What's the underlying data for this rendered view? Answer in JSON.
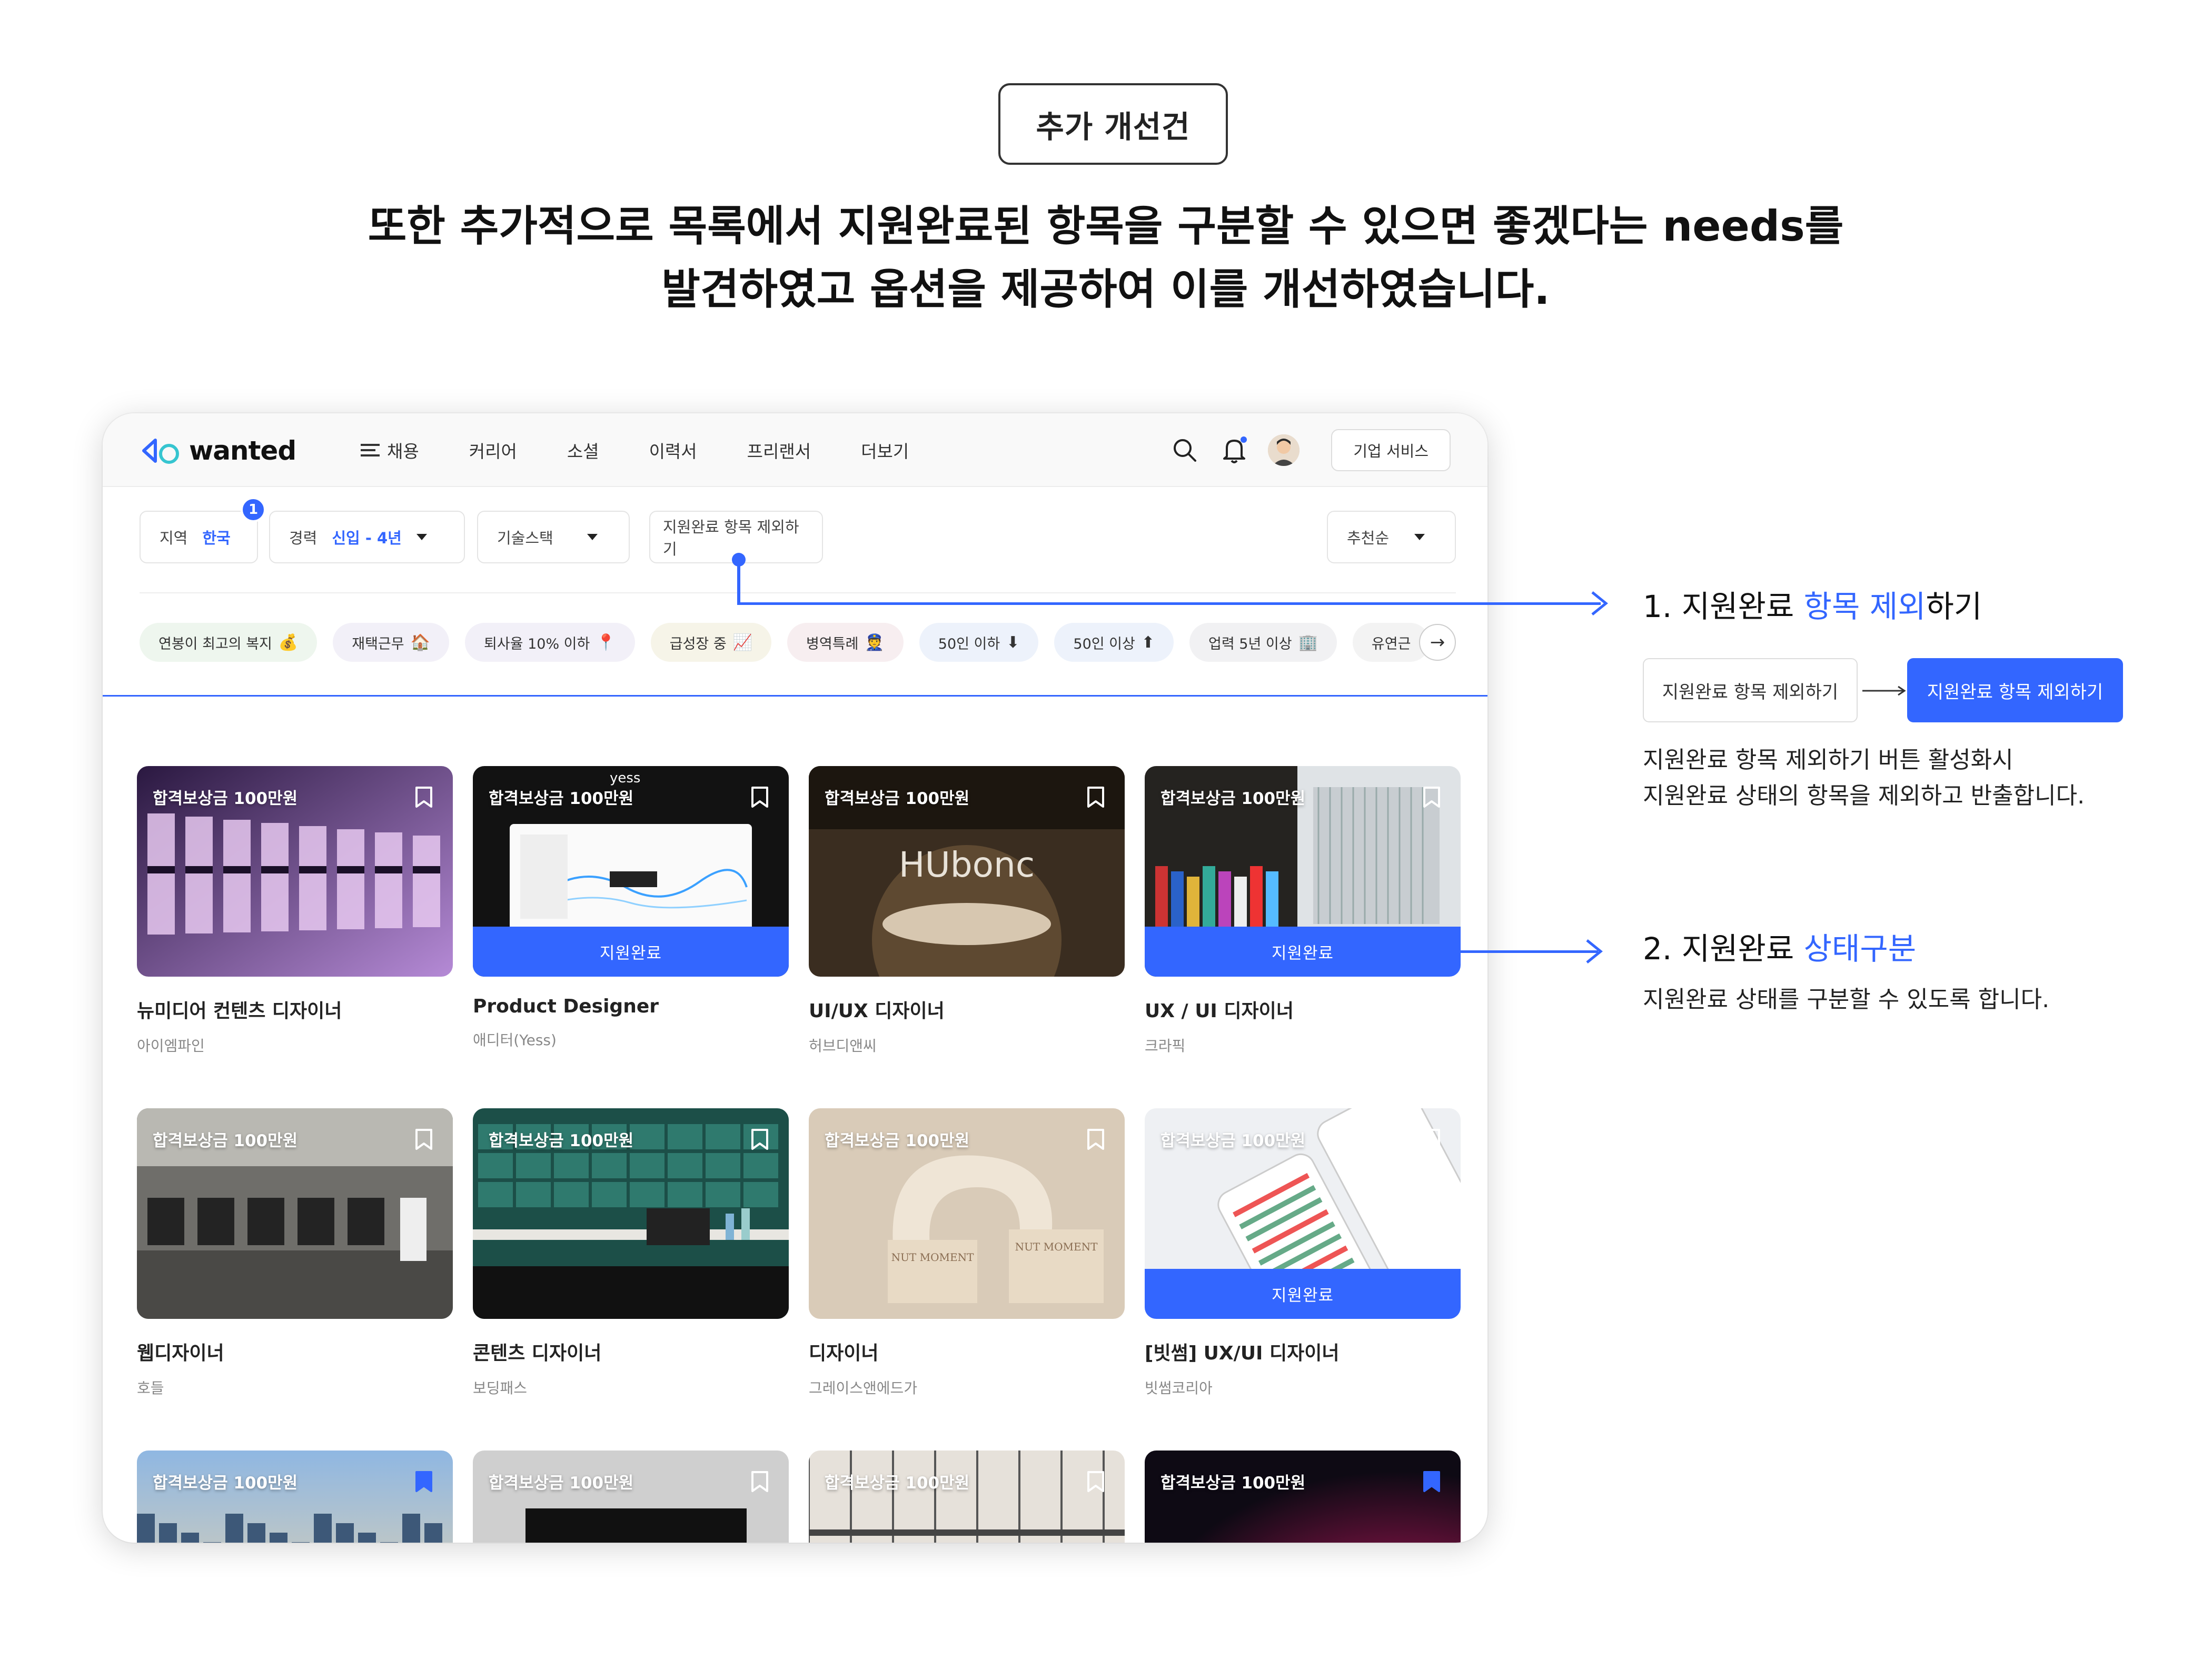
{
  "header": {
    "tag": "추가 개선건",
    "line1": "또한 추가적으로 목록에서 지원완료된 항목을 구분할 수 있으면 좋겠다는 needs를",
    "line2": "발견하였고 옵션을 제공하여 이를 개선하였습니다."
  },
  "nav": {
    "logo": "wanted",
    "menu": [
      "채용",
      "커리어",
      "소셜",
      "이력서",
      "프리랜서",
      "더보기"
    ],
    "business_button": "기업 서비스"
  },
  "filters": {
    "region_label": "지역",
    "region_value": "한국",
    "region_badge": "1",
    "career_label": "경력",
    "career_value": "신입 - 4년",
    "skill_label": "기술스택",
    "exclude_label": "지원완료 항목 제외하기",
    "sort_label": "추천순"
  },
  "tags": [
    {
      "label": "연봉이 최고의 복지",
      "emoji": "💰",
      "bg": "#eef6ee"
    },
    {
      "label": "재택근무",
      "emoji": "🏠",
      "bg": "#f2f0f8"
    },
    {
      "label": "퇴사율 10% 이하",
      "emoji": "📍",
      "bg": "#f2f0f8"
    },
    {
      "label": "급성장 중",
      "emoji": "📈",
      "bg": "#f6f4e8"
    },
    {
      "label": "병역특례",
      "emoji": "👮",
      "bg": "#f7eef0"
    },
    {
      "label": "50인 이하",
      "emoji": "⬇",
      "bg": "#edf2fb"
    },
    {
      "label": "50인 이상",
      "emoji": "⬆",
      "bg": "#edf2fb"
    },
    {
      "label": "업력 5년 이상",
      "emoji": "🏢",
      "bg": "#f1f1f3"
    },
    {
      "label": "유연근",
      "emoji": "",
      "bg": "#f3f3f3"
    }
  ],
  "card_reward": "합격보상금 100만원",
  "applied_label": "지원완료",
  "cards": [
    {
      "title": "뉴미디어 컨텐츠 디자이너",
      "company": "아이엠파인",
      "applied": false,
      "bookmarked": false
    },
    {
      "title": "Product Designer",
      "company": "애디터(Yess)",
      "applied": true,
      "bookmarked": false,
      "overlay": "yess"
    },
    {
      "title": "UI/UX 디자이너",
      "company": "허브디앤씨",
      "applied": false,
      "bookmarked": false,
      "overlay": "HUbonc"
    },
    {
      "title": "UX / UI 디자이너",
      "company": "크라픽",
      "applied": true,
      "bookmarked": false
    },
    {
      "title": "웹디자이너",
      "company": "호들",
      "applied": false,
      "bookmarked": false
    },
    {
      "title": "콘텐츠 디자이너",
      "company": "보딩패스",
      "applied": false,
      "bookmarked": false
    },
    {
      "title": "디자이너",
      "company": "그레이스앤에드가",
      "applied": false,
      "bookmarked": false,
      "overlay": "NUT MOMENT"
    },
    {
      "title": "[빗썸] UX/UI 디자이너",
      "company": "빗썸코리아",
      "applied": true,
      "bookmarked": false
    },
    {
      "title": "",
      "company": "",
      "applied": false,
      "bookmarked": true
    },
    {
      "title": "",
      "company": "",
      "applied": false,
      "bookmarked": false
    },
    {
      "title": "",
      "company": "",
      "applied": false,
      "bookmarked": false
    },
    {
      "title": "",
      "company": "",
      "applied": false,
      "bookmarked": true
    }
  ],
  "callouts": {
    "one": {
      "prefix": "1. 지원완료 ",
      "highlight": "항목 제외",
      "suffix": "하기",
      "button_off": "지원완료 항목 제외하기",
      "button_on": "지원완료 항목 제외하기",
      "desc1": "지원완료 항목 제외하기 버튼 활성화시",
      "desc2": "지원완료 상태의 항목을 제외하고 반출합니다."
    },
    "two": {
      "prefix": "2. 지원완료 ",
      "highlight": "상태구분",
      "desc1": "지원완료 상태를 구분할 수 있도록 합니다."
    }
  },
  "colors": {
    "accent": "#3366ff",
    "text": "#111111"
  }
}
